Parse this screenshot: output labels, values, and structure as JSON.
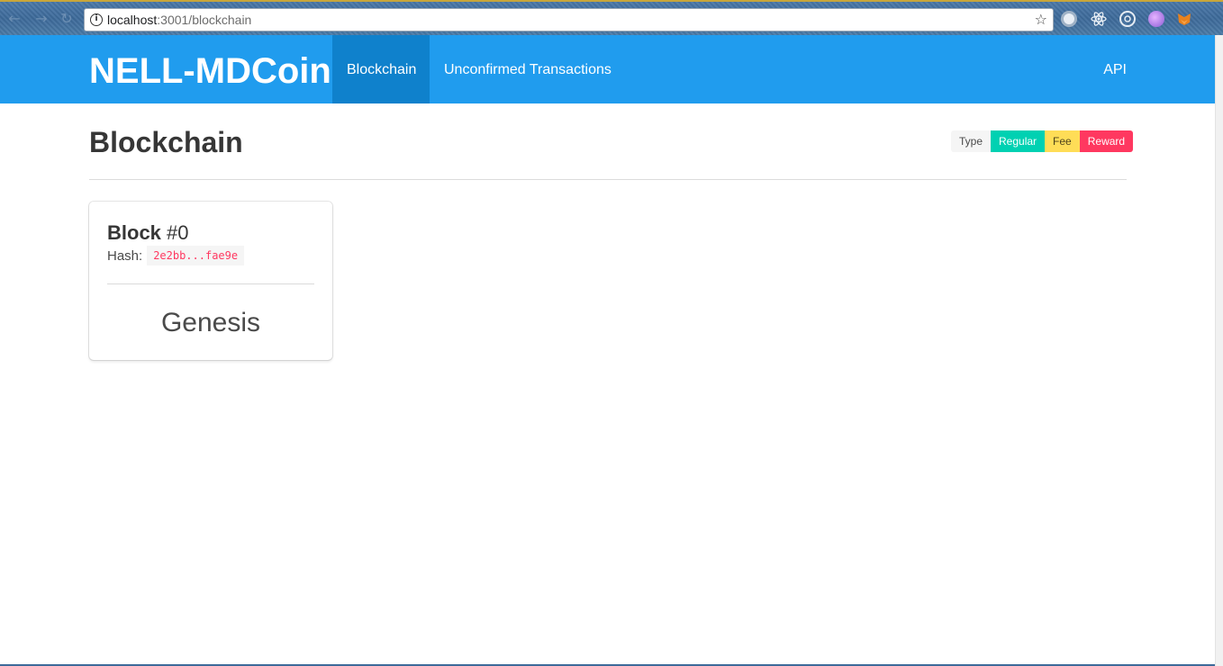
{
  "browser": {
    "url_host": "localhost",
    "url_path": ":3001/blockchain",
    "back_glyph": "←",
    "forward_glyph": "→",
    "reload_glyph": "↻",
    "star_glyph": "☆",
    "info_glyph": "i",
    "extensions": [
      {
        "name": "extension-1-icon",
        "color": "#e8eef5"
      },
      {
        "name": "react-devtools-icon",
        "color": "#dfe9f3"
      },
      {
        "name": "extension-3-icon",
        "color": "#e5ecf3"
      },
      {
        "name": "extension-4-icon",
        "color": "#c58af0"
      },
      {
        "name": "metamask-icon",
        "color": "#e8821e"
      }
    ]
  },
  "navbar": {
    "brand": "NELL-MDCoin",
    "items": [
      {
        "label": "Blockchain",
        "active": true
      },
      {
        "label": "Unconfirmed Transactions",
        "active": false
      }
    ],
    "api_label": "API",
    "color": "#209cee"
  },
  "page": {
    "title": "Blockchain",
    "legend": {
      "type": "Type",
      "regular": "Regular",
      "fee": "Fee",
      "reward": "Reward"
    }
  },
  "blocks": [
    {
      "label": "Block",
      "index": "#0",
      "hash_label": "Hash:",
      "hash": "2e2bb...fae9e",
      "content": "Genesis"
    }
  ]
}
